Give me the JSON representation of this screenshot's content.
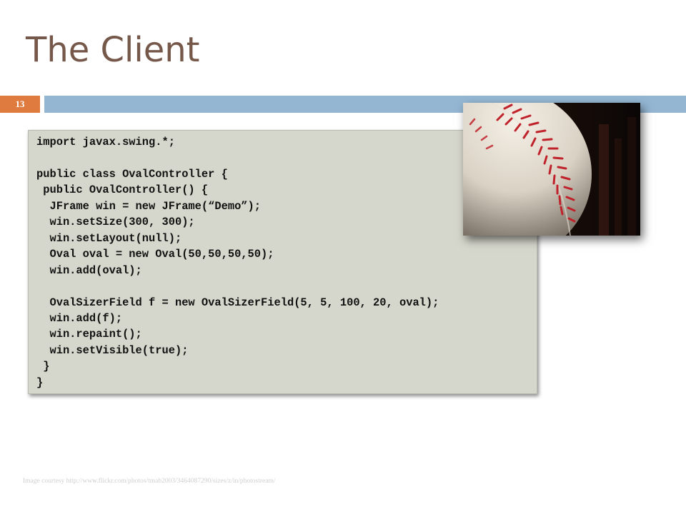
{
  "slide": {
    "title": "The Client",
    "number": "13"
  },
  "code": {
    "text": "import javax.swing.*;\n\npublic class OvalController {\n public OvalController() {\n  JFrame win = new JFrame(“Demo”);\n  win.setSize(300, 300);\n  win.setLayout(null);\n  Oval oval = new Oval(50,50,50,50);\n  win.add(oval);\n\n  OvalSizerField f = new OvalSizerField(5, 5, 100, 20, oval);\n  win.add(f);\n  win.repaint();\n  win.setVisible(true);\n }\n}"
  },
  "image": {
    "subject": "baseball-photo"
  },
  "footer": {
    "credit": "Image courtesy http://www.flickr.com/photos/tmab2003/3464087290/sizes/z/in/photostream/"
  },
  "colors": {
    "title": "#75584a",
    "accent_orange": "#e07b3f",
    "accent_blue": "#94b6d2",
    "code_background": "#d6d7cc"
  }
}
